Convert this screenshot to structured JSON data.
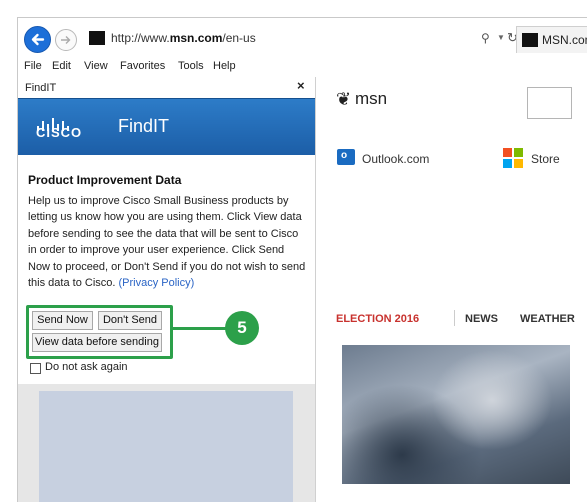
{
  "browser": {
    "url_prefix": "http://www.",
    "url_domain": "msn.com",
    "url_path": "/en-us",
    "tab_title": "MSN.com",
    "menu": [
      "File",
      "Edit",
      "View",
      "Favorites",
      "Tools",
      "Help"
    ]
  },
  "panel": {
    "title": "FindIT",
    "close_glyph": "×",
    "brand_word": "CISCO",
    "product_name": "FindIT",
    "heading": "Product Improvement Data",
    "body": "Help us to improve Cisco Small Business products by letting us know how you are using them. Click View data before sending to see the data that will be sent to Cisco in order to improve your user experience. Click Send Now to proceed, or Don't Send if you do not wish to send this data to Cisco.",
    "privacy_link": "(Privacy Policy)",
    "buttons": {
      "send_now": "Send Now",
      "dont_send": "Don't Send",
      "view_data": "View data before sending"
    },
    "checkbox_label": "Do not ask again",
    "checkbox_checked": false
  },
  "callout": {
    "number": "5",
    "color": "#2ca04a"
  },
  "msn": {
    "logo_text": "msn",
    "links": [
      {
        "label": "Outlook.com",
        "icon": "outlook-icon"
      },
      {
        "label": "Store",
        "icon": "windows-store-icon"
      }
    ],
    "nav": {
      "election": "ELECTION 2016",
      "news": "NEWS",
      "weather": "WEATHER"
    }
  },
  "colors": {
    "cisco_blue": "#1f66b3",
    "link_blue": "#2a64c5",
    "election_red": "#c8322e"
  }
}
